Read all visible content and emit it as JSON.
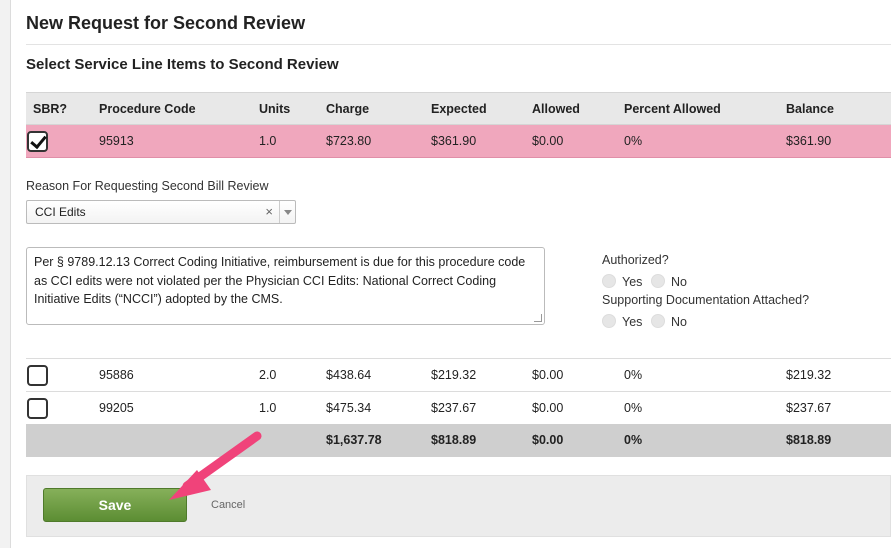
{
  "page": {
    "title": "New Request for Second Review",
    "section_title": "Select Service Line Items to Second Review"
  },
  "table": {
    "headers": {
      "sbr": "SBR?",
      "code": "Procedure Code",
      "units": "Units",
      "charge": "Charge",
      "expected": "Expected",
      "allowed": "Allowed",
      "pct": "Percent Allowed",
      "balance": "Balance"
    },
    "rows": [
      {
        "checked": true,
        "code": "95913",
        "units": "1.0",
        "charge": "$723.80",
        "expected": "$361.90",
        "allowed": "$0.00",
        "pct": "0%",
        "balance": "$361.90"
      },
      {
        "checked": false,
        "code": "95886",
        "units": "2.0",
        "charge": "$438.64",
        "expected": "$219.32",
        "allowed": "$0.00",
        "pct": "0%",
        "balance": "$219.32"
      },
      {
        "checked": false,
        "code": "99205",
        "units": "1.0",
        "charge": "$475.34",
        "expected": "$237.67",
        "allowed": "$0.00",
        "pct": "0%",
        "balance": "$237.67"
      }
    ],
    "totals": {
      "charge": "$1,637.78",
      "expected": "$818.89",
      "allowed": "$0.00",
      "pct": "0%",
      "balance": "$818.89"
    }
  },
  "reason": {
    "label": "Reason For Requesting Second Bill Review",
    "selected": "CCI Edits",
    "clear_glyph": "×"
  },
  "notes": {
    "text": "Per § 9789.12.13 Correct Coding Initiative, reimbursement is due for this procedure code as CCI edits were not violated per the Physician CCI Edits: National Correct Coding Initiative Edits (“NCCI”) adopted by the CMS."
  },
  "questions": {
    "authorized": {
      "label": "Authorized?",
      "yes": "Yes",
      "no": "No"
    },
    "supporting": {
      "label": "Supporting Documentation Attached?",
      "yes": "Yes",
      "no": "No"
    }
  },
  "actions": {
    "save": "Save",
    "cancel": "Cancel"
  },
  "colors": {
    "selected_row": "#f0a7bd",
    "save_button": "#6a9a3e",
    "annotation_arrow": "#f0437a"
  }
}
